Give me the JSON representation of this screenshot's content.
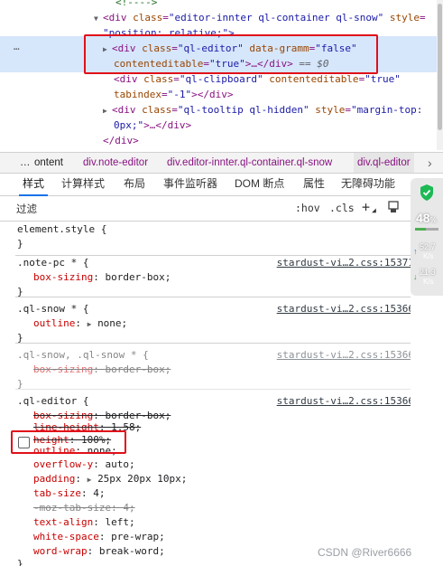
{
  "dom_tree": {
    "lines": [
      {
        "text": "<!---->"
      },
      {
        "tag_open": "<div",
        "attr1": "class",
        "val1": "\"editor-innter ql-container ql-snow\"",
        "attr2": "style",
        "val2": "="
      },
      {
        "val": "\"position: relative;\">"
      },
      {
        "tag_open": "<div",
        "attr1": "class",
        "val1": "\"ql-editor\"",
        "attr2": "data-gramm",
        "val2": "\"false\""
      },
      {
        "attr": "contenteditable",
        "val": "\"true\"",
        "tail": ">…</div>",
        "eq": "== $0"
      },
      {
        "tag_open": "<div",
        "attr1": "class",
        "val1": "\"ql-clipboard\"",
        "attr2": "contenteditable",
        "val2": "\"true\""
      },
      {
        "attr": "tabindex",
        "val": "\"-1\"",
        "tail": "></div>"
      },
      {
        "tag_open": "<div",
        "attr1": "class",
        "val1": "\"ql-tooltip ql-hidden\"",
        "attr2": "style",
        "val2": "\"margin-top:"
      },
      {
        "val": "0px;\"",
        "tail": ">…</div>"
      },
      {
        "text": "</div>"
      }
    ],
    "ellipsis": "…"
  },
  "breadcrumb": {
    "more": "…",
    "items": [
      "ontent",
      "div.note-editor",
      "div.editor-innter.ql-container.ql-snow",
      "div.ql-editor"
    ],
    "scroll_icon": "›"
  },
  "tabs": [
    "样式",
    "计算样式",
    "布局",
    "事件监听器",
    "DOM 断点",
    "属性",
    "无障碍功能"
  ],
  "toolbar": {
    "filter_placeholder": "过滤",
    "hov": ":hov",
    "cls": ".cls",
    "plus": "+"
  },
  "styles": {
    "element_style": {
      "selector": "element.style {",
      "close": "}"
    },
    "rules": [
      {
        "selector": ".note-pc * {",
        "source": "stardust-vi…2.css:15371",
        "props": [
          {
            "name": "box-sizing",
            "value": "border-box;"
          }
        ]
      },
      {
        "selector": ".ql-snow * {",
        "source": "stardust-vi…2.css:15366",
        "props": [
          {
            "name": "outline",
            "value": "none;",
            "tri": "▶"
          }
        ]
      },
      {
        "selector": ".ql-snow, .ql-snow * {",
        "source": "stardust-vi…2.css:15366",
        "props": [
          {
            "name": "box-sizing",
            "value": "border-box;"
          }
        ]
      },
      {
        "selector": ".ql-editor {",
        "source": "stardust-vi…2.css:15366",
        "props": [
          {
            "name": "box-sizing",
            "value": "border-box;"
          },
          {
            "name": "line-height",
            "value": "1.58;"
          },
          {
            "name": "height",
            "value": "100%;"
          },
          {
            "name": "outline",
            "value": "none;"
          },
          {
            "name": "overflow-y",
            "value": "auto;"
          },
          {
            "name": "padding",
            "value": "25px 20px 10px;",
            "tri": "▶"
          },
          {
            "name": "tab-size",
            "value": "4;"
          },
          {
            "name": "-moz-tab-size",
            "value": "4;"
          },
          {
            "name": "text-align",
            "value": "left;"
          },
          {
            "name": "white-space",
            "value": "pre-wrap;"
          },
          {
            "name": "word-wrap",
            "value": "break-word;"
          }
        ],
        "close": "}"
      }
    ],
    "close": "}"
  },
  "side_widget": {
    "cpu": "48",
    "cpu_unit": "%",
    "cpu_level": 0.48,
    "up_speed": "52.7",
    "up_unit": "K/s",
    "down_speed": "21.3",
    "down_unit": "K/s"
  },
  "watermark": "CSDN @River6666",
  "colors": {
    "annotation": "#e0101a",
    "selection": "#d6e6fb",
    "active_tab": "#1a73e8"
  }
}
